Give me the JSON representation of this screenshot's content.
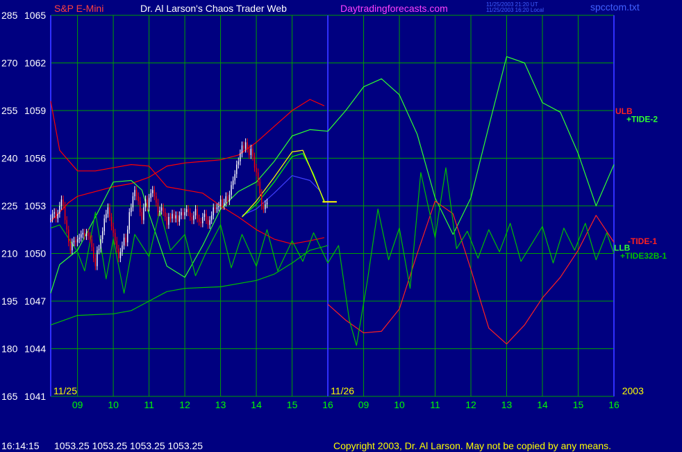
{
  "header": {
    "symbol": "S&P E-Mini",
    "site_title": "Dr. Al Larson's Chaos Trader Web",
    "url": "Daytradingforecasts.com",
    "timestamp_ut": "11/25/2003 21:20 UT",
    "timestamp_local": "11/25/2003 16:20 Local",
    "filename": "spcctom.txt"
  },
  "footer": {
    "time": "16:14:15",
    "quote": "1053.25 1053.25 1053.25 1053.25",
    "copyright": "Copyright 2003, Dr. Al Larson. May not be copied by any means."
  },
  "colors": {
    "background": "#000080",
    "grid": "#00A000",
    "divider": "#3030FF",
    "price_up": "#FFFFFF",
    "price_down": "#FF0000",
    "symbol_label": "#FF4040",
    "url_label": "#FF40FF",
    "timestamp_label": "#4060FF",
    "hour_label": "#00FF00",
    "date_label": "#FFFF00",
    "band": "#FF0000",
    "tide2": "#30FF30",
    "tide32b": "#00C000",
    "tide1": "#FF2020",
    "ma_blue": "#4040FF",
    "ma_green": "#00FF00",
    "ma_yellow": "#FFFF00"
  },
  "chart_data": {
    "type": "line",
    "y_left_ticks": [
      "285",
      "270",
      "255",
      "240",
      "225",
      "210",
      "195",
      "180",
      "165"
    ],
    "y_right_ticks": [
      "1065",
      "1062",
      "1059",
      "1056",
      "1053",
      "1050",
      "1047",
      "1044",
      "1041"
    ],
    "ylim": [
      1041,
      1065
    ],
    "xlim": [
      8.25,
      24
    ],
    "x_hours": [
      {
        "label": "09",
        "x": 9
      },
      {
        "label": "10",
        "x": 10
      },
      {
        "label": "11",
        "x": 11
      },
      {
        "label": "12",
        "x": 12
      },
      {
        "label": "13",
        "x": 13
      },
      {
        "label": "14",
        "x": 14
      },
      {
        "label": "15",
        "x": 15
      },
      {
        "label": "16",
        "x": 16
      },
      {
        "label": "09",
        "x": 17
      },
      {
        "label": "10",
        "x": 18
      },
      {
        "label": "11",
        "x": 19
      },
      {
        "label": "12",
        "x": 20
      },
      {
        "label": "13",
        "x": 21
      },
      {
        "label": "14",
        "x": 22
      },
      {
        "label": "15",
        "x": 23
      },
      {
        "label": "16",
        "x": 24
      }
    ],
    "day_labels": [
      {
        "label": "11/25",
        "x": 8.25
      },
      {
        "label": "11/26",
        "x": 16.0
      },
      {
        "label": "2003",
        "x": 24.15
      }
    ],
    "day_divider_x": 16.0,
    "series_labels": [
      {
        "label": "ULB",
        "y": 1059.0,
        "color": "#FF2020"
      },
      {
        "label": "+TIDE-2",
        "y": 1058.5,
        "color": "#30FF30"
      },
      {
        "label": "-TIDE-1",
        "y": 1050.8,
        "color": "#FF2020"
      },
      {
        "label": "LLB",
        "y": 1050.4,
        "color": "#30FF30"
      },
      {
        "label": "+TIDE32B-1",
        "y": 1049.9,
        "color": "#00C000"
      }
    ],
    "series": [
      {
        "name": "ULB",
        "color": "#FF0000",
        "x": [
          8.25,
          8.5,
          8.75,
          9.0,
          9.5,
          10.0,
          10.5,
          11.0,
          11.5,
          12.0,
          12.5,
          13.0,
          13.5,
          14.0,
          14.5,
          15.0,
          15.5,
          15.9
        ],
        "y": [
          1052.0,
          1052.6,
          1053.2,
          1053.6,
          1053.9,
          1054.2,
          1054.4,
          1054.8,
          1055.5,
          1055.7,
          1055.8,
          1055.9,
          1056.2,
          1057.0,
          1058.0,
          1059.0,
          1059.7,
          1059.3
        ]
      },
      {
        "name": "LLB",
        "color": "#FF0000",
        "x": [
          8.25,
          8.5,
          9.0,
          9.5,
          10.0,
          10.5,
          11.0,
          11.5,
          12.0,
          12.5,
          13.0,
          13.5,
          14.0,
          14.5,
          15.0,
          15.5,
          15.9
        ],
        "y": [
          1059.6,
          1056.5,
          1055.2,
          1055.2,
          1055.4,
          1055.6,
          1055.5,
          1054.2,
          1054.0,
          1053.8,
          1053.0,
          1052.3,
          1051.5,
          1050.9,
          1050.6,
          1050.8,
          1051.0
        ]
      },
      {
        "name": "lower_band",
        "color": "#00C000",
        "x": [
          8.25,
          9.0,
          10.0,
          10.5,
          11.0,
          11.5,
          12.0,
          13.0,
          14.0,
          14.5,
          15.0,
          15.5,
          16.0
        ],
        "y": [
          1045.5,
          1046.1,
          1046.2,
          1046.4,
          1047.0,
          1047.6,
          1047.8,
          1047.9,
          1048.3,
          1048.7,
          1049.4,
          1050.2,
          1050.5
        ]
      },
      {
        "name": "TIDE-2",
        "color": "#30FF30",
        "x": [
          8.25,
          8.5,
          9.0,
          9.5,
          10.0,
          10.5,
          10.8,
          11.0,
          11.5,
          12.0,
          12.5,
          13.0,
          13.5,
          14.0,
          14.5,
          15.0,
          15.5,
          16.0,
          16.5,
          17.0,
          17.5,
          18.0,
          18.5,
          19.0,
          19.5,
          20.0,
          20.5,
          21.0,
          21.5,
          22.0,
          22.5,
          23.0,
          23.5,
          24.0
        ],
        "y": [
          1047.5,
          1049.3,
          1050.2,
          1052.3,
          1054.5,
          1054.6,
          1054.0,
          1052.5,
          1049.2,
          1048.5,
          1050.5,
          1052.8,
          1053.9,
          1054.5,
          1055.8,
          1057.4,
          1057.8,
          1057.7,
          1059.0,
          1060.5,
          1061.0,
          1060.0,
          1057.5,
          1053.5,
          1051.2,
          1053.5,
          1058.0,
          1062.4,
          1062.0,
          1059.5,
          1058.9,
          1056.3,
          1053.0,
          1055.6
        ]
      },
      {
        "name": "TIDE-1",
        "color": "#FF2020",
        "x": [
          16.0,
          16.5,
          17.0,
          17.5,
          18.0,
          18.5,
          19.0,
          19.5,
          20.0,
          20.5,
          21.0,
          21.5,
          22.0,
          22.5,
          23.0,
          23.5,
          24.0
        ],
        "y": [
          1046.8,
          1045.8,
          1045.0,
          1045.1,
          1046.5,
          1050.0,
          1053.3,
          1052.5,
          1049.0,
          1045.3,
          1044.3,
          1045.5,
          1047.2,
          1048.5,
          1050.2,
          1052.4,
          1050.7
        ]
      },
      {
        "name": "TIDE32B-1",
        "color": "#00C000",
        "x": [
          8.25,
          8.5,
          9.0,
          9.2,
          9.5,
          9.8,
          10.0,
          10.3,
          10.6,
          11.0,
          11.3,
          11.6,
          12.0,
          12.3,
          12.6,
          13.0,
          13.3,
          13.6,
          14.0,
          14.3,
          14.6,
          15.0,
          15.3,
          15.6,
          16.0,
          16.3,
          16.6,
          16.8,
          17.1,
          17.4,
          17.7,
          18.0,
          18.3,
          18.6,
          19.0,
          19.3,
          19.6,
          19.9,
          20.2,
          20.5,
          20.8,
          21.1,
          21.4,
          21.7,
          22.0,
          22.3,
          22.6,
          22.9,
          23.2,
          23.5,
          23.8,
          24.0
        ],
        "y": [
          1051.6,
          1051.8,
          1050.1,
          1048.9,
          1052.6,
          1048.4,
          1050.9,
          1047.5,
          1051.2,
          1049.8,
          1052.7,
          1050.2,
          1051.2,
          1048.6,
          1050.1,
          1051.8,
          1049.1,
          1051.2,
          1049.2,
          1051.5,
          1048.9,
          1050.8,
          1049.5,
          1051.3,
          1049.4,
          1050.5,
          1045.8,
          1044.2,
          1048.2,
          1052.8,
          1049.6,
          1051.6,
          1047.8,
          1055.1,
          1051.0,
          1055.4,
          1050.3,
          1051.4,
          1049.7,
          1051.5,
          1050.1,
          1051.9,
          1049.5,
          1050.6,
          1051.7,
          1049.4,
          1051.6,
          1050.2,
          1051.9,
          1049.6,
          1051.3,
          1050.0
        ]
      },
      {
        "name": "ma_blue",
        "color": "#4040FF",
        "x": [
          13.6,
          14.0,
          14.5,
          15.0,
          15.5,
          15.8
        ],
        "y": [
          1052.4,
          1052.8,
          1053.8,
          1054.9,
          1054.6,
          1053.9
        ]
      },
      {
        "name": "ma_green",
        "color": "#00FF00",
        "x": [
          13.6,
          14.0,
          14.5,
          15.0,
          15.3,
          15.6,
          15.9
        ],
        "y": [
          1052.3,
          1053.1,
          1054.5,
          1056.1,
          1056.3,
          1055.0,
          1053.2
        ]
      },
      {
        "name": "ma_yellow",
        "color": "#FFFF00",
        "x": [
          13.6,
          14.0,
          14.5,
          15.0,
          15.3,
          15.6,
          15.9
        ],
        "y": [
          1052.3,
          1053.3,
          1054.8,
          1056.4,
          1056.5,
          1054.9,
          1053.3
        ]
      }
    ],
    "last_price_marker": {
      "x": [
        15.85,
        16.25
      ],
      "y": 1053.25,
      "color": "#FFFF00"
    },
    "price_bars": {
      "x_start": 8.25,
      "x_step": 0.05,
      "closes": [
        1052.2,
        1052.5,
        1052.6,
        1052.2,
        1052.5,
        1053.0,
        1053.4,
        1053.0,
        1052.1,
        1051.5,
        1050.7,
        1050.2,
        1050.7,
        1050.8,
        1050.7,
        1050.9,
        1051.0,
        1051.2,
        1051.3,
        1051.1,
        1051.3,
        1051.1,
        1050.9,
        1050.4,
        1049.7,
        1049.2,
        1050.2,
        1050.3,
        1050.9,
        1051.4,
        1052.2,
        1052.5,
        1052.9,
        1052.3,
        1051.7,
        1051.3,
        1050.8,
        1050.3,
        1049.7,
        1050.1,
        1050.5,
        1051.0,
        1050.7,
        1051.5,
        1052.6,
        1052.9,
        1053.6,
        1054.0,
        1053.6,
        1053.3,
        1052.6,
        1052.1,
        1052.9,
        1053.4,
        1052.9,
        1053.5,
        1053.8,
        1054.0,
        1053.6,
        1053.2,
        1052.6,
        1052.7,
        1052.9,
        1052.6,
        1052.3,
        1051.8,
        1052.3,
        1052.2,
        1052.5,
        1052.2,
        1052.4,
        1052.0,
        1052.4,
        1052.6,
        1052.4,
        1052.6,
        1052.8,
        1052.6,
        1052.3,
        1052.1,
        1052.4,
        1052.8,
        1052.2,
        1052.0,
        1051.9,
        1052.3,
        1052.5,
        1052.1,
        1051.8,
        1052.1,
        1052.4,
        1052.9,
        1052.8,
        1052.9,
        1053.0,
        1053.4,
        1053.0,
        1053.2,
        1053.6,
        1053.3,
        1053.7,
        1054.3,
        1054.6,
        1055.0,
        1055.6,
        1055.8,
        1056.3,
        1056.8,
        1056.6,
        1057.0,
        1056.6,
        1056.2,
        1056.6,
        1056.1,
        1055.4,
        1055.1,
        1054.5,
        1053.8,
        1053.0,
        1052.8,
        1053.1,
        1053.2
      ]
    }
  }
}
